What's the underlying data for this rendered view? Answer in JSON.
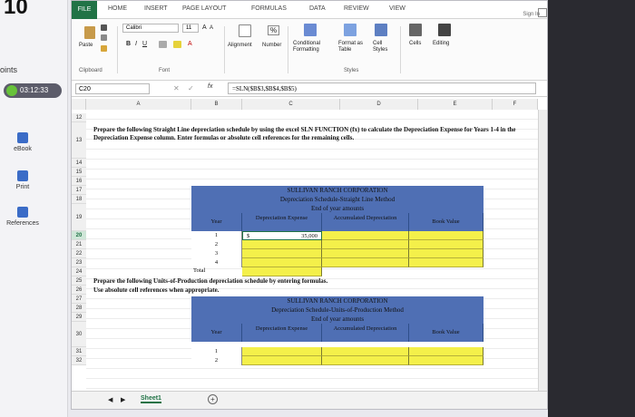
{
  "side": {
    "question_number": "10",
    "points_label": "oints",
    "timer": "03:12:33",
    "items": [
      {
        "label": "eBook"
      },
      {
        "label": "Print"
      },
      {
        "label": "References"
      }
    ]
  },
  "ribbon": {
    "tabs": [
      "FILE",
      "HOME",
      "INSERT",
      "PAGE LAYOUT",
      "FORMULAS",
      "DATA",
      "REVIEW",
      "VIEW"
    ],
    "sign_in": "Sign In",
    "paste": "Paste",
    "font_name": "Calibri",
    "font_size": "11",
    "alignment": "Alignment",
    "number": "Number",
    "percent": "%",
    "conditional_formatting": "Conditional Formatting",
    "format_as_table": "Format as Table",
    "cell_styles": "Cell Styles",
    "cells": "Cells",
    "editing": "Editing",
    "groups": [
      "Clipboard",
      "Font",
      "Styles"
    ]
  },
  "formula_bar": {
    "name_box": "C20",
    "fx": "fx",
    "formula": "=SLN($B$3,$B$4,$B$5)"
  },
  "grid": {
    "columns": [
      "A",
      "B",
      "C",
      "D",
      "E",
      "F"
    ],
    "rows": [
      "12",
      "13",
      "14",
      "15",
      "16",
      "17",
      "18",
      "19",
      "20",
      "21",
      "22",
      "23",
      "24",
      "25",
      "26",
      "27",
      "28",
      "29",
      "30",
      "31",
      "32"
    ],
    "selected_row": "20"
  },
  "instructions": {
    "sl_text": "Prepare the following Straight Line depreciation schedule by using the excel SLN FUNCTION (fx) to calculate the Depreciation Expense for Years 1-4 in the Depreciation Expense column. Enter formulas or absolute cell references for the remaining cells.",
    "uop_line1": "Prepare the following Units-of-Production depreciation schedule by entering formulas.",
    "uop_line2": "Use absolute cell references when appropriate."
  },
  "table1": {
    "title": "SULLIVAN RANCH CORPORATION",
    "subtitle": "Depreciation Schedule-Straight Line Method",
    "period": "End of year amounts",
    "col_year": "Year",
    "col_dep_expense": "Depreciation Expense",
    "col_accum": "Accumulated Depreciation",
    "col_book": "Book Value",
    "years": [
      "1",
      "2",
      "3",
      "4"
    ],
    "first_dollar": "$",
    "first_value": "35,000",
    "total_label": "Total"
  },
  "table2": {
    "title": "SULLIVAN RANCH CORPORATION",
    "subtitle": "Depreciation Schedule-Units-of-Production Method",
    "period": "End of year amounts",
    "col_year": "Year",
    "col_dep_expense": "Depreciation Expense",
    "col_accum": "Accumulated Depreciation",
    "col_book": "Book Value",
    "years": [
      "1",
      "2"
    ]
  },
  "sheet": {
    "tab": "Sheet1",
    "add": "+"
  },
  "colors": {
    "excel_green": "#217346",
    "header_blue": "#4f6fb4",
    "input_yellow": "#f4f04a"
  }
}
